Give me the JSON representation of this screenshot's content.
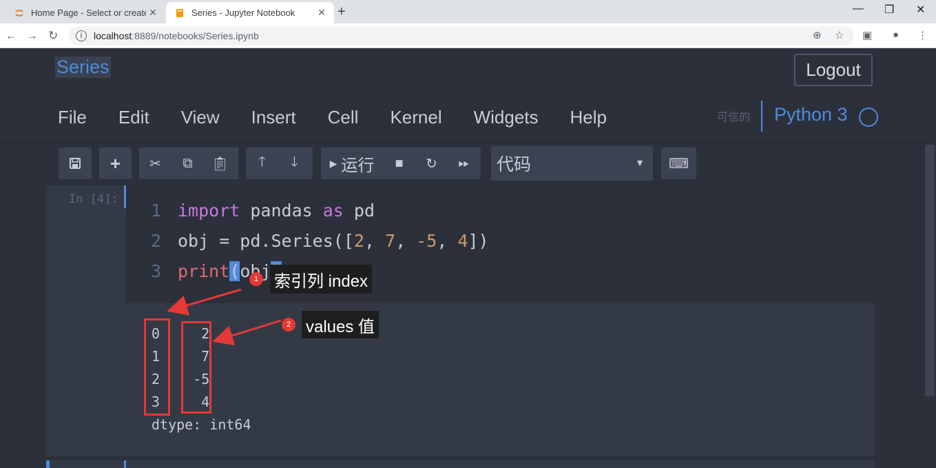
{
  "browser": {
    "tabs": [
      {
        "title": "Home Page - Select or create a",
        "favicon": "jupyter-logo-icon",
        "active": false
      },
      {
        "title": "Series - Jupyter Notebook",
        "favicon": "notebook-icon",
        "active": true
      }
    ],
    "url_host": "localhost",
    "url_path": ":8889/notebooks/Series.ipynb"
  },
  "notebook": {
    "title": "Series",
    "logout_label": "Logout",
    "menu": [
      "File",
      "Edit",
      "View",
      "Insert",
      "Cell",
      "Kernel",
      "Widgets",
      "Help"
    ],
    "trusted_label": "可信的",
    "kernel_name": "Python 3"
  },
  "toolbar": {
    "run_label": "运行",
    "cell_type": "代码"
  },
  "cell": {
    "prompt": "In [4]:",
    "line_numbers": [
      "1",
      "2",
      "3"
    ],
    "code": {
      "line1": {
        "kw1": "import",
        "mod": " pandas ",
        "kw2": "as",
        "alias": " pd"
      },
      "line2": {
        "pre": "obj = pd.Series([",
        "n1": "2",
        "c1": ", ",
        "n2": "7",
        "c2": ", ",
        "n3": "-5",
        "c3": ", ",
        "n4": "4",
        "post": "])"
      },
      "line3": {
        "fn": "print",
        "open": "(",
        "arg": "obj",
        "close": ")"
      }
    },
    "output": [
      "0     2",
      "1     7",
      "2    -5",
      "3     4",
      "dtype: int64"
    ]
  },
  "annotations": [
    {
      "badge": "1",
      "label": "索引列 index"
    },
    {
      "badge": "2",
      "label": "values 值"
    }
  ],
  "colors": {
    "annotation": "#e53935",
    "accent": "#4f8bdb",
    "background": "#2b303b"
  }
}
